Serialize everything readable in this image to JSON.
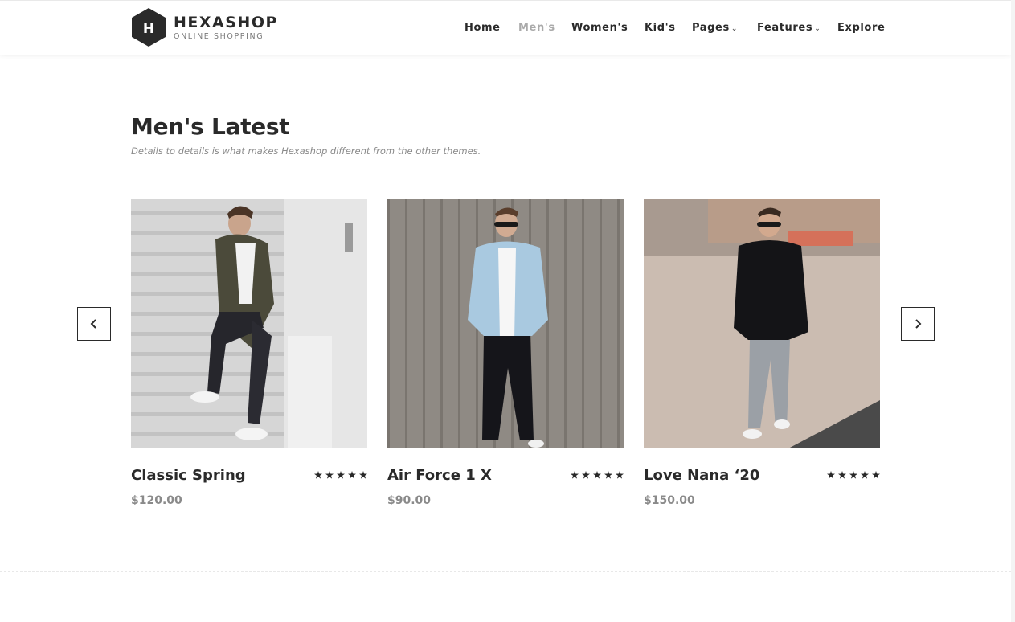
{
  "brand": {
    "title": "HEXASHOP",
    "subtitle": "ONLINE SHOPPING",
    "badge_letter": "H",
    "badge_color": "#2a2a2a"
  },
  "nav": {
    "items": [
      {
        "label": "Home",
        "active": false,
        "dropdown": false
      },
      {
        "label": "Men's",
        "active": true,
        "dropdown": false
      },
      {
        "label": "Women's",
        "active": false,
        "dropdown": false
      },
      {
        "label": "Kid's",
        "active": false,
        "dropdown": false
      },
      {
        "label": "Pages",
        "active": false,
        "dropdown": true
      },
      {
        "label": "Features",
        "active": false,
        "dropdown": true
      },
      {
        "label": "Explore",
        "active": false,
        "dropdown": false
      }
    ],
    "caret_icon": "chevron-down-icon"
  },
  "section": {
    "title": "Men's Latest",
    "subtitle": "Details to details is what makes Hexashop different from the other themes."
  },
  "carousel": {
    "prev_icon": "chevron-left-icon",
    "next_icon": "chevron-right-icon"
  },
  "products": [
    {
      "name": "Classic Spring",
      "price": "$120.00",
      "rating": 5,
      "image": "man-camo-jacket-on-stairs"
    },
    {
      "name": "Air Force 1 X",
      "price": "$90.00",
      "rating": 5,
      "image": "man-denim-jacket-wooden-wall"
    },
    {
      "name": "Love Nana ‘20",
      "price": "$150.00",
      "rating": 5,
      "image": "man-black-sweater-street"
    }
  ],
  "colors": {
    "text": "#2a2a2a",
    "muted": "#8a8a8a",
    "active_nav": "#aaaaaa"
  }
}
